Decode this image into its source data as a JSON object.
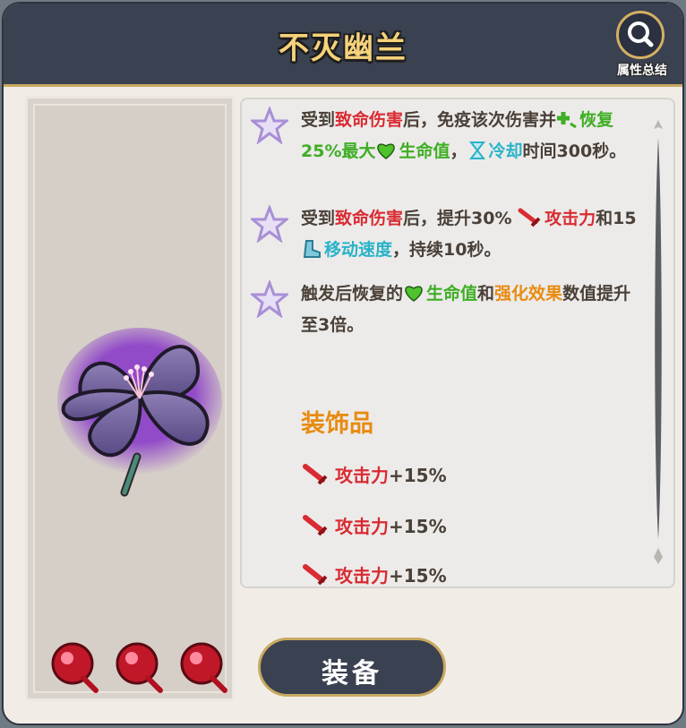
{
  "header": {
    "title": "不灭幽兰",
    "summary_label": "属性总结"
  },
  "effects": [
    {
      "parts": [
        {
          "t": "受到",
          "c": ""
        },
        {
          "t": "致命伤害",
          "c": "red"
        },
        {
          "t": "后，免疫该次伤害并",
          "c": ""
        },
        {
          "t": "恢复25%最大",
          "c": "green",
          "icon": "heal-plus-icon"
        },
        {
          "t": "生命值",
          "c": "green",
          "icon": "heart-icon"
        },
        {
          "t": "，",
          "c": ""
        },
        {
          "t": "冷却",
          "c": "cyan",
          "icon": "hourglass-icon"
        },
        {
          "t": "时间300秒。",
          "c": ""
        }
      ]
    },
    {
      "parts": [
        {
          "t": "受到",
          "c": ""
        },
        {
          "t": "致命伤害",
          "c": "red"
        },
        {
          "t": "后，提升30% ",
          "c": ""
        },
        {
          "t": "攻击力",
          "c": "red",
          "icon": "sword-icon"
        },
        {
          "t": "和15 ",
          "c": ""
        },
        {
          "t": "移动速度",
          "c": "cyan",
          "icon": "boot-icon"
        },
        {
          "t": "，持续10秒。",
          "c": ""
        }
      ]
    },
    {
      "parts": [
        {
          "t": "触发后恢复的",
          "c": ""
        },
        {
          "t": "生命值",
          "c": "green",
          "icon": "heart-icon"
        },
        {
          "t": "和",
          "c": ""
        },
        {
          "t": "强化效果",
          "c": "orange"
        },
        {
          "t": "数值提升至3倍。",
          "c": ""
        }
      ]
    }
  ],
  "accessory": {
    "title": "装饰品",
    "stats": [
      {
        "name": "攻击力",
        "value": "+15%"
      },
      {
        "name": "攻击力",
        "value": "+15%"
      },
      {
        "name": "攻击力",
        "value": "+15%"
      }
    ]
  },
  "equip_label": "装备",
  "colors": {
    "header_bg": "#3a4150",
    "gold": "#c9a961",
    "title": "#f6d27a",
    "red": "#d92b32",
    "green": "#3fae24",
    "cyan": "#2ab3c8",
    "orange": "#e88b11"
  }
}
